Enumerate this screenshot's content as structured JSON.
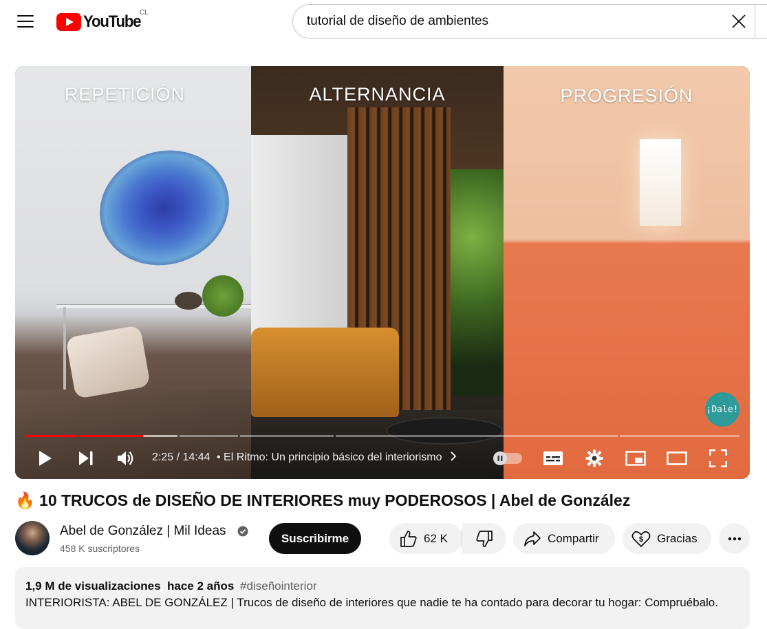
{
  "masthead": {
    "logo_text": "YouTube",
    "country_code": "CL",
    "search_value": "tutorial de diseño de ambientes"
  },
  "player": {
    "panels": [
      "REPETICIÓN",
      "ALTERNANCIA",
      "PROGRESIÓN"
    ],
    "badge_text": "¡Dale!",
    "time": "2:25 / 14:44",
    "chapter": "• El Ritmo: Un principio básico del interiorismo",
    "progress_fraction": 0.1644
  },
  "video": {
    "title_emoji": "🔥",
    "title": "10 TRUCOS de DISEÑO DE INTERIORES muy PODEROSOS | Abel de González",
    "channel_name": "Abel de González | Mil Ideas",
    "subscribers": "458 K suscriptores",
    "subscribe_label": "Suscribirme",
    "likes": "62 K",
    "share_label": "Compartir",
    "thanks_label": "Gracias"
  },
  "description": {
    "views": "1,9 M de visualizaciones",
    "age": "hace 2 años",
    "hashtag": "#diseñointerior",
    "text": "INTERIORISTA: ABEL DE GONZÁLEZ | Trucos de diseño de interiores que nadie te ha contado para decorar tu hogar: Compruébalo."
  },
  "icons": [
    "menu-icon",
    "youtube-logo-icon",
    "clear-icon",
    "play-icon",
    "next-icon",
    "volume-icon",
    "chevron-right-icon",
    "pause-icon",
    "subtitles-icon",
    "settings-icon",
    "miniplayer-icon",
    "theater-icon",
    "fullscreen-icon",
    "verified-icon",
    "like-icon",
    "dislike-icon",
    "share-icon",
    "thanks-icon",
    "more-icon"
  ],
  "colors": {
    "brand": "#ff0000",
    "text": "#0f0f0f",
    "secondary": "#606060",
    "pill": "#f2f2f2",
    "badge": "#2e9b9a"
  }
}
